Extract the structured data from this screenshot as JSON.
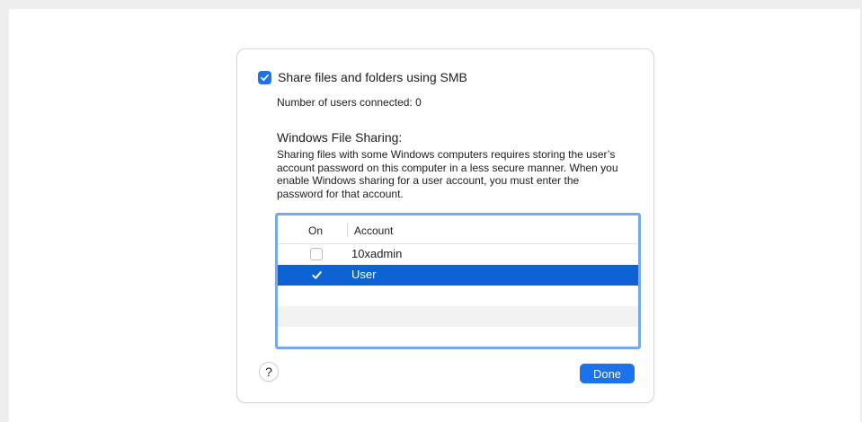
{
  "dialog": {
    "smb_checkbox": {
      "label": "Share files and folders using SMB",
      "checked": true
    },
    "users_connected": "Number of users connected: 0",
    "windows_sharing": {
      "heading": "Windows File Sharing:",
      "description": "Sharing files with some Windows computers requires storing the user’s account password on this computer in a less secure manner. When you enable Windows sharing for a user account, you must enter the password for that account."
    },
    "accounts_table": {
      "columns": {
        "on": "On",
        "account": "Account"
      },
      "rows": [
        {
          "account": "10xadmin",
          "on": false,
          "selected": false
        },
        {
          "account": "User",
          "on": true,
          "selected": true
        }
      ]
    },
    "help_button": "?",
    "done_button": "Done"
  },
  "colors": {
    "accent": "#1a73e8",
    "selection": "#0e63d2",
    "table_focus_ring": "#7aa7e8"
  }
}
